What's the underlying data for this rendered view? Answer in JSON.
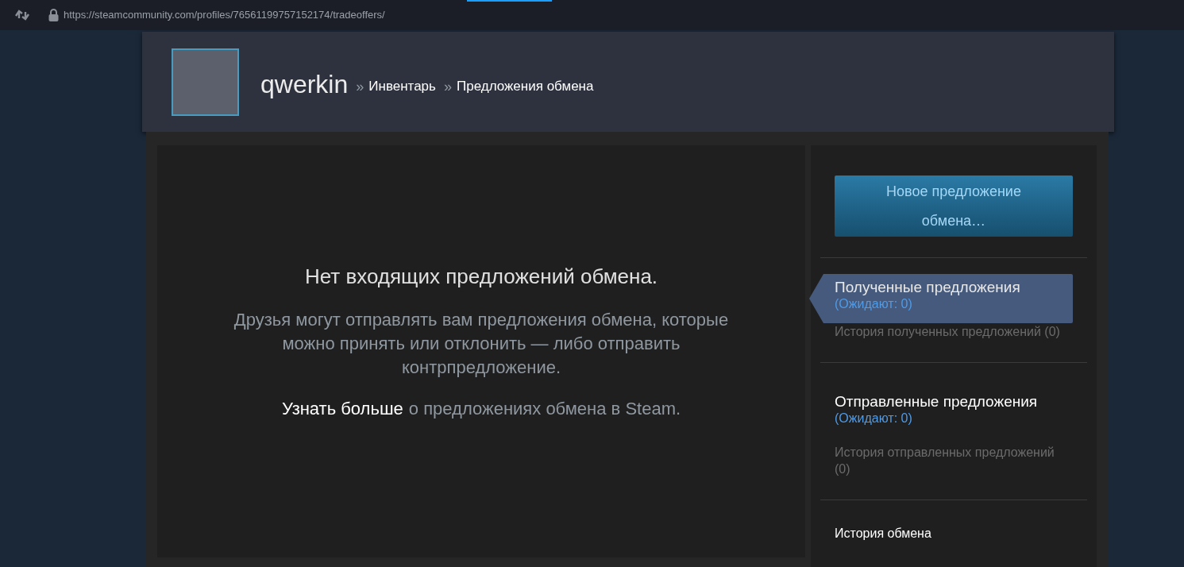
{
  "address_bar": {
    "url": "https://steamcommunity.com/profiles/76561199757152174/tradeoffers/"
  },
  "profile": {
    "name": "qwerkin",
    "breadcrumbs": [
      {
        "separator": "»",
        "label": "Инвентарь"
      },
      {
        "separator": "»",
        "label": "Предложения обмена"
      }
    ]
  },
  "empty_state": {
    "title": "Нет входящих предложений обмена.",
    "body": "Друзья могут отправлять вам предложения обмена, которые можно принять или отклонить — либо отправить контрпредложение.",
    "link": "Узнать больше",
    "link_rest": "о предложениях обмена в Steam."
  },
  "sidebar": {
    "new_offer_button": "Новое предложение обмена…",
    "sections": [
      {
        "title": "Полученные предложения",
        "pending": "(Ожидают: 0)",
        "selected": true,
        "history": "История полученных предложений (0)"
      },
      {
        "title": "Отправленные предложения",
        "pending": "(Ожидают: 0)",
        "selected": false,
        "history": "История отправленных предложений (0)"
      }
    ],
    "trade_history": "История обмена"
  }
}
